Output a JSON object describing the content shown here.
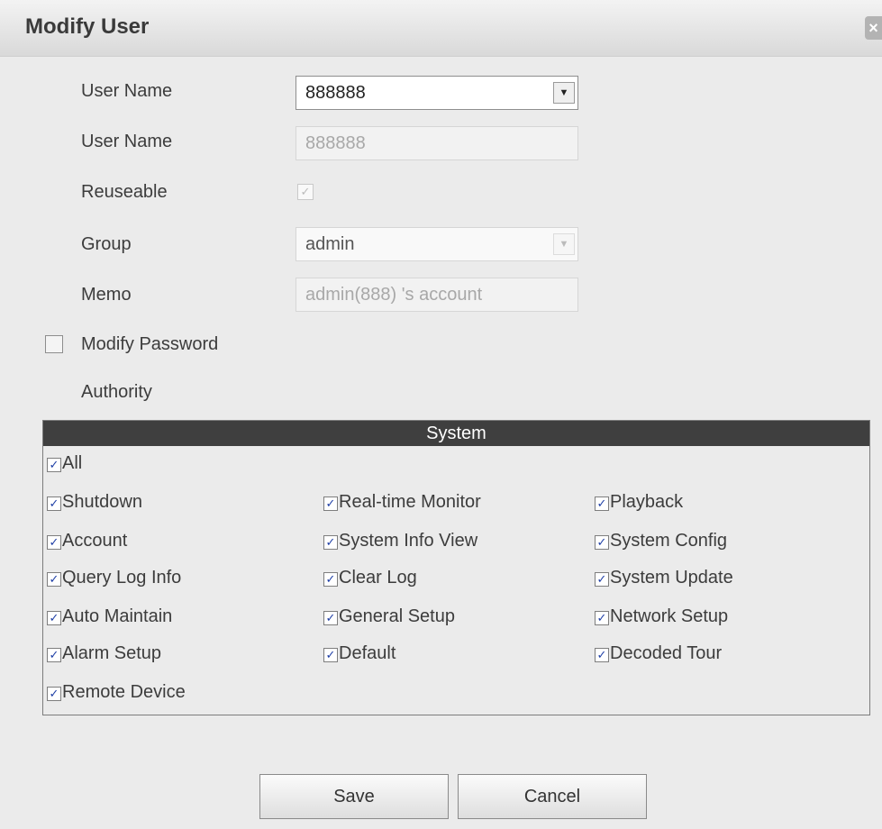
{
  "dialog": {
    "title": "Modify User",
    "close_glyph": "×"
  },
  "form": {
    "user_select_label": "User Name",
    "user_select_value": "888888",
    "user_name_label": "User Name",
    "user_name_value": "888888",
    "reuseable_label": "Reuseable",
    "reuseable_checked": true,
    "group_label": "Group",
    "group_value": "admin",
    "memo_label": "Memo",
    "memo_value": "admin(888) 's account",
    "modify_password_label": "Modify Password",
    "modify_password_checked": false,
    "authority_label": "Authority"
  },
  "authority": {
    "section_title": "System",
    "check_glyph": "✓",
    "permissions": [
      {
        "label": "All",
        "checked": true
      },
      {
        "label": "Shutdown",
        "checked": true
      },
      {
        "label": "Real-time Monitor",
        "checked": true
      },
      {
        "label": "Playback",
        "checked": true
      },
      {
        "label": "Account",
        "checked": true
      },
      {
        "label": "System Info View",
        "checked": true
      },
      {
        "label": "System Config",
        "checked": true
      },
      {
        "label": "Query Log Info",
        "checked": true
      },
      {
        "label": "Clear Log",
        "checked": true
      },
      {
        "label": "System Update",
        "checked": true
      },
      {
        "label": "Auto Maintain",
        "checked": true
      },
      {
        "label": "General Setup",
        "checked": true
      },
      {
        "label": "Network Setup",
        "checked": true
      },
      {
        "label": "Alarm Setup",
        "checked": true
      },
      {
        "label": "Default",
        "checked": true
      },
      {
        "label": "Decoded Tour",
        "checked": true
      },
      {
        "label": "Remote Device",
        "checked": true
      }
    ]
  },
  "buttons": {
    "save": "Save",
    "cancel": "Cancel"
  }
}
